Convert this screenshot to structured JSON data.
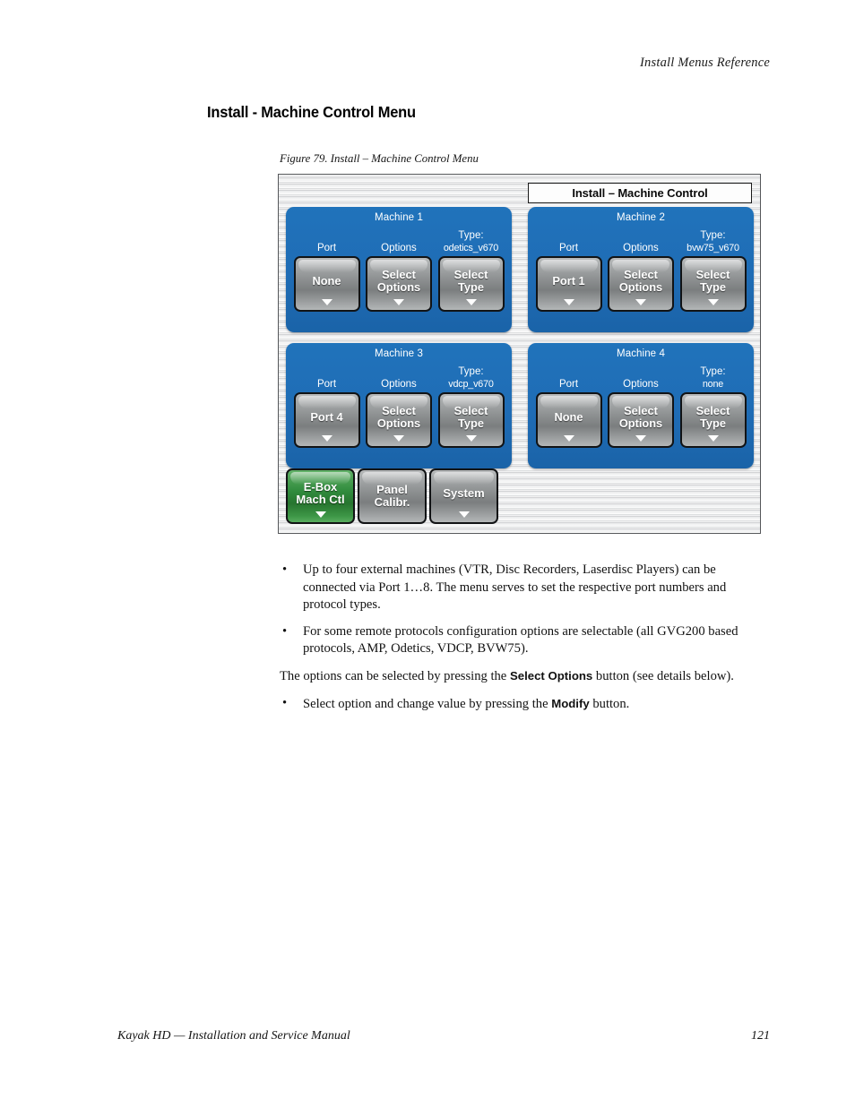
{
  "page": {
    "running_head": "Install Menus Reference",
    "section_heading": "Install - Machine Control Menu",
    "figure_caption": "Figure 79.  Install – Machine Control Menu",
    "footer_left": "Kayak HD  —  Installation and Service Manual",
    "footer_page": "121"
  },
  "menu": {
    "title": "Install – Machine Control",
    "colors": {
      "panel_blue": "#1f6cb5",
      "button_gray": "#8e9192",
      "button_green": "#2f8a3c",
      "bezel_metal": "#d8d9da",
      "text_white": "#ffffff"
    },
    "column_headers": {
      "port": "Port",
      "options": "Options",
      "type": "Type:"
    },
    "machines": [
      {
        "title": "Machine 1",
        "port_label": "Port",
        "port_value": "None",
        "options_label": "Options",
        "options_button": "Select Options",
        "options_button_line1": "Select",
        "options_button_line2": "Options",
        "type_label": "Type:",
        "type_value": "odetics_v670",
        "type_button_line1": "Select",
        "type_button_line2": "Type"
      },
      {
        "title": "Machine 2",
        "port_label": "Port",
        "port_value": "Port 1",
        "options_label": "Options",
        "options_button": "Select Options",
        "options_button_line1": "Select",
        "options_button_line2": "Options",
        "type_label": "Type:",
        "type_value": "bvw75_v670",
        "type_button_line1": "Select",
        "type_button_line2": "Type"
      },
      {
        "title": "Machine 3",
        "port_label": "Port",
        "port_value": "Port 4",
        "options_label": "Options",
        "options_button": "Select Options",
        "options_button_line1": "Select",
        "options_button_line2": "Options",
        "type_label": "Type:",
        "type_value": "vdcp_v670",
        "type_button_line1": "Select",
        "type_button_line2": "Type"
      },
      {
        "title": "Machine 4",
        "port_label": "Port",
        "port_value": "None",
        "options_label": "Options",
        "options_button": "Select Options",
        "options_button_line1": "Select",
        "options_button_line2": "Options",
        "type_label": "Type:",
        "type_value": "none",
        "type_button_line1": "Select",
        "type_button_line2": "Type"
      }
    ],
    "bottom_buttons": [
      {
        "line1": "E-Box",
        "line2": "Mach Ctl",
        "selected": true,
        "has_arrow": true
      },
      {
        "line1": "Panel",
        "line2": "Calibr.",
        "selected": false,
        "has_arrow": false
      },
      {
        "line1": "System",
        "line2": "",
        "selected": false,
        "has_arrow": true
      }
    ]
  },
  "body": {
    "bullet1": "Up to four external machines (VTR, Disc Recorders, Laserdisc Players) can be connected via Port 1…8. The menu serves to set the respective port numbers and protocol types.",
    "bullet2": "For some remote protocols configuration options are selectable (all GVG200 based protocols, AMP, Odetics, VDCP, BVW75).",
    "para_before_bold": "The options can be selected by pressing the ",
    "para_bold": "Select Options",
    "para_after_bold": " button (see details below).",
    "bullet3_before_bold": "Select option and change value by pressing the ",
    "bullet3_bold": "Modify",
    "bullet3_after_bold": " button.",
    "bullet_marker": "•"
  }
}
